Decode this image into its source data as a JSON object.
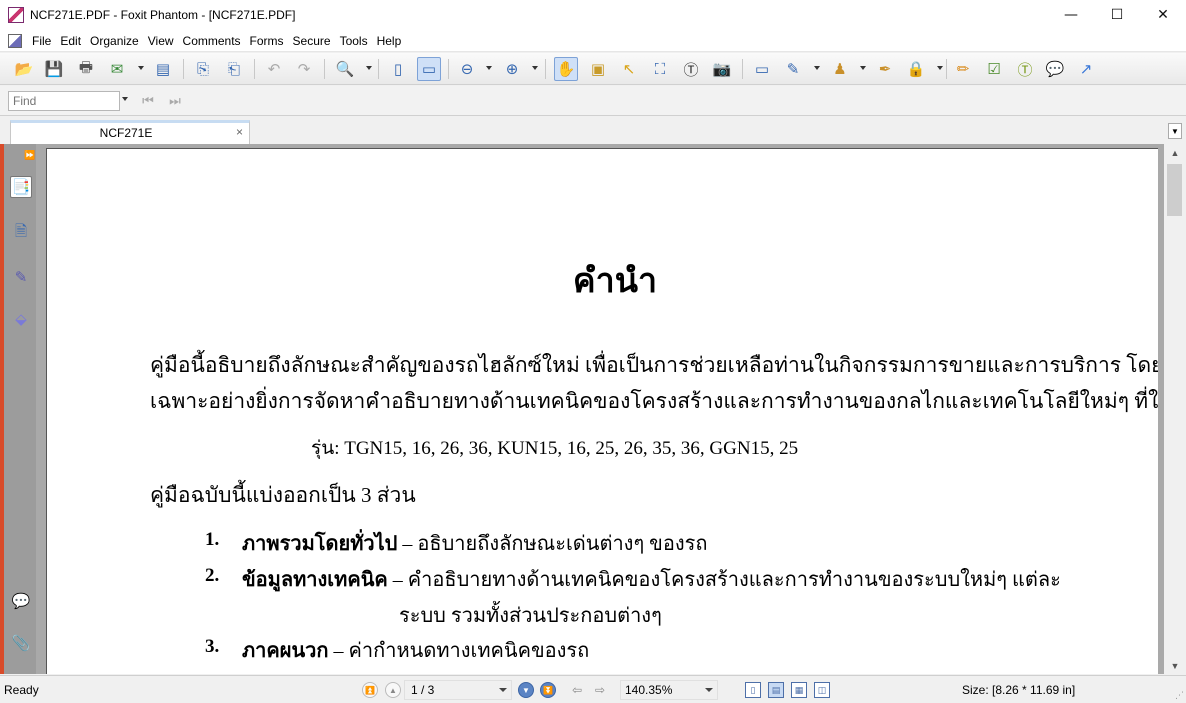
{
  "window": {
    "title": "NCF271E.PDF - Foxit Phantom - [NCF271E.PDF]",
    "minimize": "—",
    "maximize": "☐",
    "close": "✕"
  },
  "menu": [
    "File",
    "Edit",
    "Organize",
    "View",
    "Comments",
    "Forms",
    "Secure",
    "Tools",
    "Help"
  ],
  "find": {
    "placeholder": "Find"
  },
  "tab": {
    "label": "NCF271E",
    "close": "×"
  },
  "document": {
    "title": "คำนำ",
    "para1_line1": "คู่มือนี้อธิบายถึงลักษณะสำคัญของรถไฮลักซ์ใหม่   เพื่อเป็นการช่วยเหลือท่านในกิจกรรมการขายและการบริการ   โดย",
    "para1_line2": "เฉพาะอย่างยิ่งการจัดหาคำอธิบายทางด้านเทคนิคของโครงสร้างและการทำงานของกลไกและเทคโนโลยีใหม่ๆ ที่ใช้",
    "models": "รุ่น: TGN15, 16, 26, 36, KUN15, 16, 25, 26, 35, 36, GGN15, 25",
    "intro": "คู่มือฉบับนี้แบ่งออกเป็น  3  ส่วน",
    "items": [
      {
        "num": "1.",
        "bold": "ภาพรวมโดยทั่วไป",
        "text": " – อธิบายถึงลักษณะเด่นต่างๆ ของรถ"
      },
      {
        "num": "2.",
        "bold": "ข้อมูลทางเทคนิค",
        "text": " – คำอธิบายทางด้านเทคนิคของโครงสร้างและการทำงานของระบบใหม่ๆ แต่ละ",
        "cont": "ระบบ รวมทั้งส่วนประกอบต่างๆ"
      },
      {
        "num": "3.",
        "bold": "ภาคผนวก",
        "text": " – ค่ากำหนดทางเทคนิคของรถ"
      }
    ]
  },
  "status": {
    "ready": "Ready",
    "page": "1 / 3",
    "zoom": "140.35%",
    "size": "Size: [8.26 * 11.69 in]"
  },
  "colors": {
    "accent": "#3567b0",
    "nav_border": "#d84b2a",
    "tab_highlight": "#c7dcf2"
  }
}
